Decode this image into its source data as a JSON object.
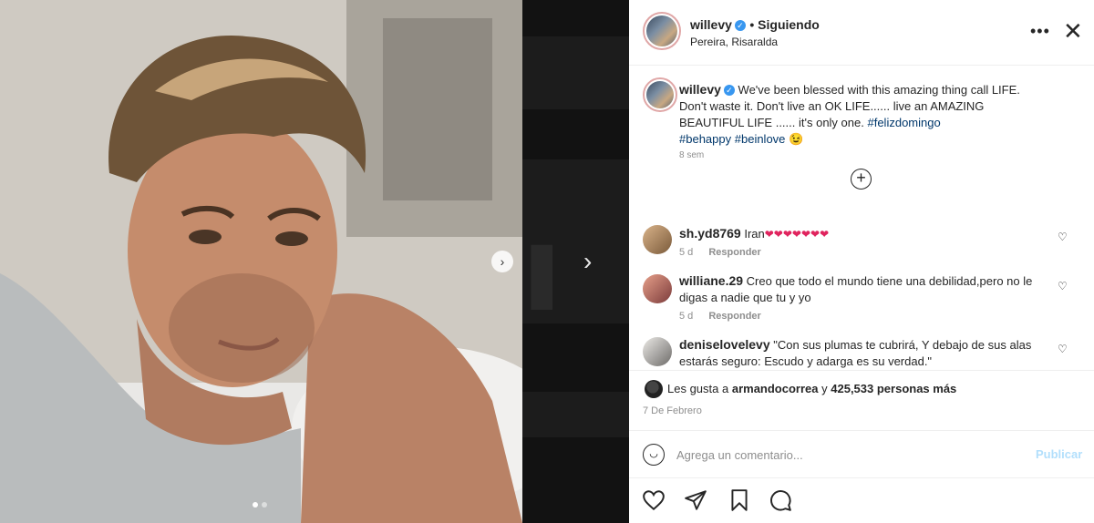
{
  "post": {
    "username": "willevy",
    "follow_status": "• Siguiendo",
    "location": "Pereira, Risaralda",
    "more_icon": "more-horizontal-icon",
    "close_icon": "close-icon"
  },
  "caption": {
    "username": "willevy",
    "text": "We've been blessed with this amazing thing call LIFE. Don't waste it. Don't live an OK LIFE...... live an AMAZING BEAUTIFUL LIFE ...... it's only one.",
    "hashtags": [
      "#felizdomingo",
      "#behappy",
      "#beinlove"
    ],
    "emoji": "😉",
    "time": "8 sem"
  },
  "comments": [
    {
      "username": "sh.yd8769",
      "text": "Iran",
      "hearts": "❤❤❤❤❤❤❤",
      "time": "5 d",
      "reply_label": "Responder"
    },
    {
      "username": "williane.29",
      "text": "Creo que todo el mundo tiene una debilidad,pero no le digas a nadie que tu y yo",
      "time": "5 d",
      "reply_label": "Responder"
    },
    {
      "username": "deniselovelevy",
      "text": "\"Con sus plumas te cubrirá, Y debajo de sus alas estarás seguro: Escudo y adarga es su verdad.\""
    }
  ],
  "likes": {
    "prefix": "Les gusta a",
    "user": "armandocorrea",
    "connector": "y",
    "count": "425,533 personas más"
  },
  "date": "7 De Febrero",
  "comment_box": {
    "placeholder": "Agrega un comentario...",
    "publish_label": "Publicar"
  },
  "colors": {
    "verified": "#3897f0",
    "hashtag": "#00376b",
    "publish_disabled": "#b2dffc",
    "heart": "#e0245e"
  },
  "carousel": {
    "slide_count": 2,
    "active_slide": 1
  }
}
